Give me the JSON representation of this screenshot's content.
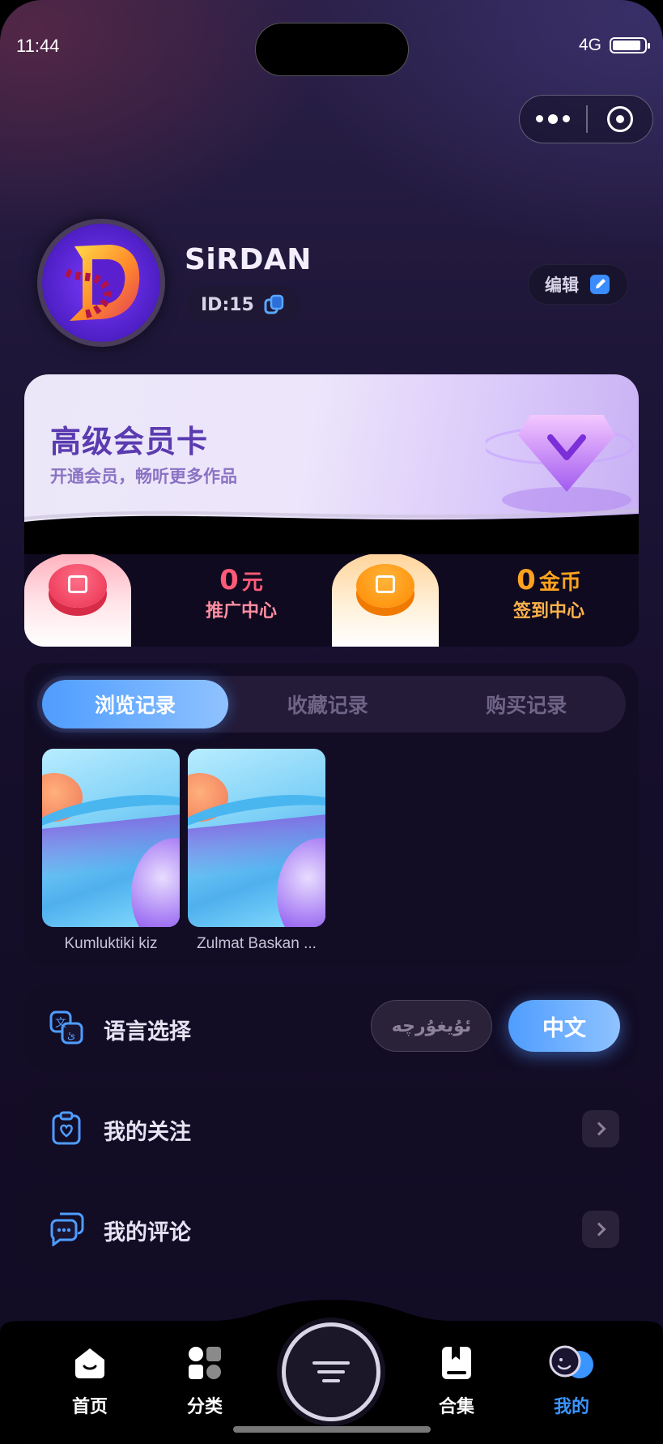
{
  "status_bar": {
    "time": "11:44",
    "network": "4G",
    "battery_level": 0.9
  },
  "profile": {
    "name": "SiRDAN",
    "id_label": "ID:15",
    "edit_label": "编辑"
  },
  "vip_card": {
    "title": "高级会员卡",
    "subtitle": "开通会员，畅听更多作品"
  },
  "stats": [
    {
      "value": "0",
      "unit": "元",
      "label": "推广中心",
      "color": "#ff5a78"
    },
    {
      "value": "0",
      "unit": "金币",
      "label": "签到中心",
      "color": "#ffa21f"
    }
  ],
  "records": {
    "tabs": [
      "浏览记录",
      "收藏记录",
      "购买记录"
    ],
    "active_tab": "浏览记录",
    "items": [
      {
        "title": "Kumluktiki kiz"
      },
      {
        "title": "Zulmat Baskan ..."
      }
    ]
  },
  "language": {
    "label": "语言选择",
    "options": [
      "ئۇيغۇرچە",
      "中文"
    ],
    "selected": "中文"
  },
  "menu": [
    {
      "label": "我的关注",
      "icon": "heart-clipboard-icon"
    },
    {
      "label": "我的评论",
      "icon": "comment-bubbles-icon"
    }
  ],
  "bottom_nav": {
    "items": [
      "首页",
      "分类",
      "合集",
      "我的"
    ],
    "active": "我的"
  },
  "colors": {
    "accent_blue": "#4f9dff",
    "background": "#150e2a"
  }
}
